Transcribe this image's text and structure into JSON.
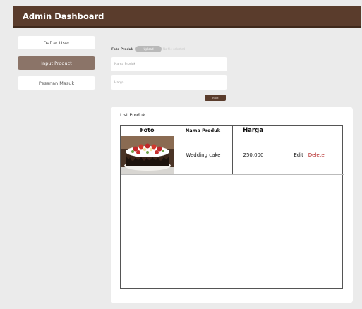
{
  "header": {
    "title": "Admin Dashboard"
  },
  "sidebar": {
    "items": [
      {
        "label": "Daftar User",
        "active": false
      },
      {
        "label": "Input Product",
        "active": true
      },
      {
        "label": "Pesanan Masuk",
        "active": false
      }
    ]
  },
  "form": {
    "photo_label": "Foto Produk",
    "upload_label": "Upload",
    "file_status": "No file selected",
    "name_placeholder": "Nama Produk",
    "price_placeholder": "Harga",
    "submit_label": "Input"
  },
  "product_list": {
    "title": "List Produk",
    "columns": [
      "Foto",
      "Nama Produk",
      "Harga",
      ""
    ],
    "rows": [
      {
        "photo_icon": "cake-photo",
        "name": "Wedding cake",
        "price": "250.000",
        "edit_label": "Edit",
        "separator": " | ",
        "delete_label": "Delete"
      }
    ]
  },
  "colors": {
    "header_bg": "#5a3c2c",
    "active_item_bg": "#8b7468",
    "delete_link": "#b22222",
    "page_bg": "#ebebeb"
  }
}
